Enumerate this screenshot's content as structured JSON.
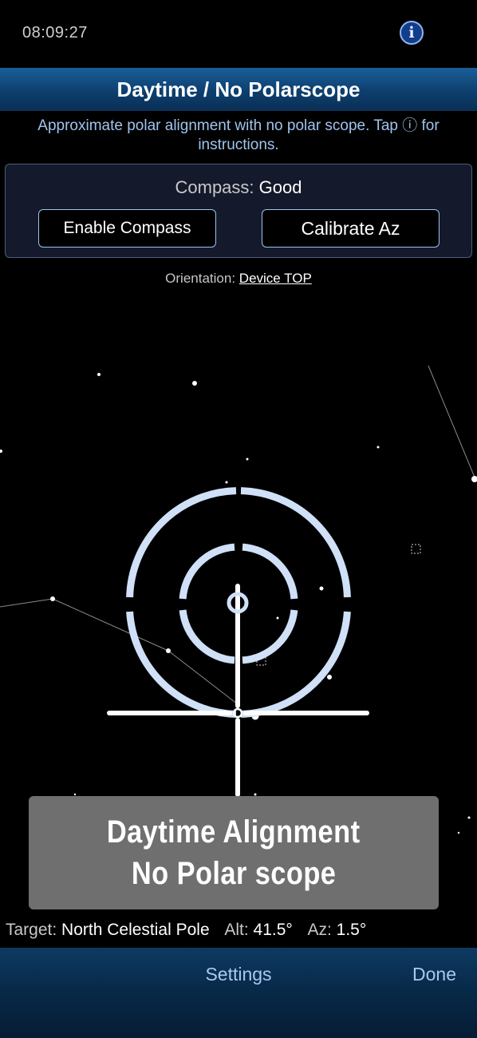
{
  "status_bar": {
    "time": "08:09:27",
    "info_icon": "info-circle-icon",
    "info_glyph": "i"
  },
  "header": {
    "title": "Daytime / No Polarscope"
  },
  "instructions": {
    "text": "Approximate polar alignment with no polar scope. Tap ⓘ for instructions."
  },
  "compass": {
    "label": "Compass:",
    "status": "Good",
    "enable_label": "Enable Compass",
    "calibrate_label": "Calibrate Az"
  },
  "orientation": {
    "label": "Orientation:",
    "value": "Device TOP"
  },
  "banner": {
    "line1": "Daytime Alignment",
    "line2": "No Polar scope"
  },
  "target": {
    "label": "Target:",
    "name": "North Celestial Pole",
    "alt_label": "Alt:",
    "alt_value": "41.5°",
    "az_label": "Az:",
    "az_value": "1.5°"
  },
  "bottom_bar": {
    "settings_label": "Settings",
    "done_label": "Done"
  },
  "colors": {
    "reticle": "#cfe0f7",
    "accent": "#9fc4ee",
    "header_blue": "#0d3f6e"
  }
}
